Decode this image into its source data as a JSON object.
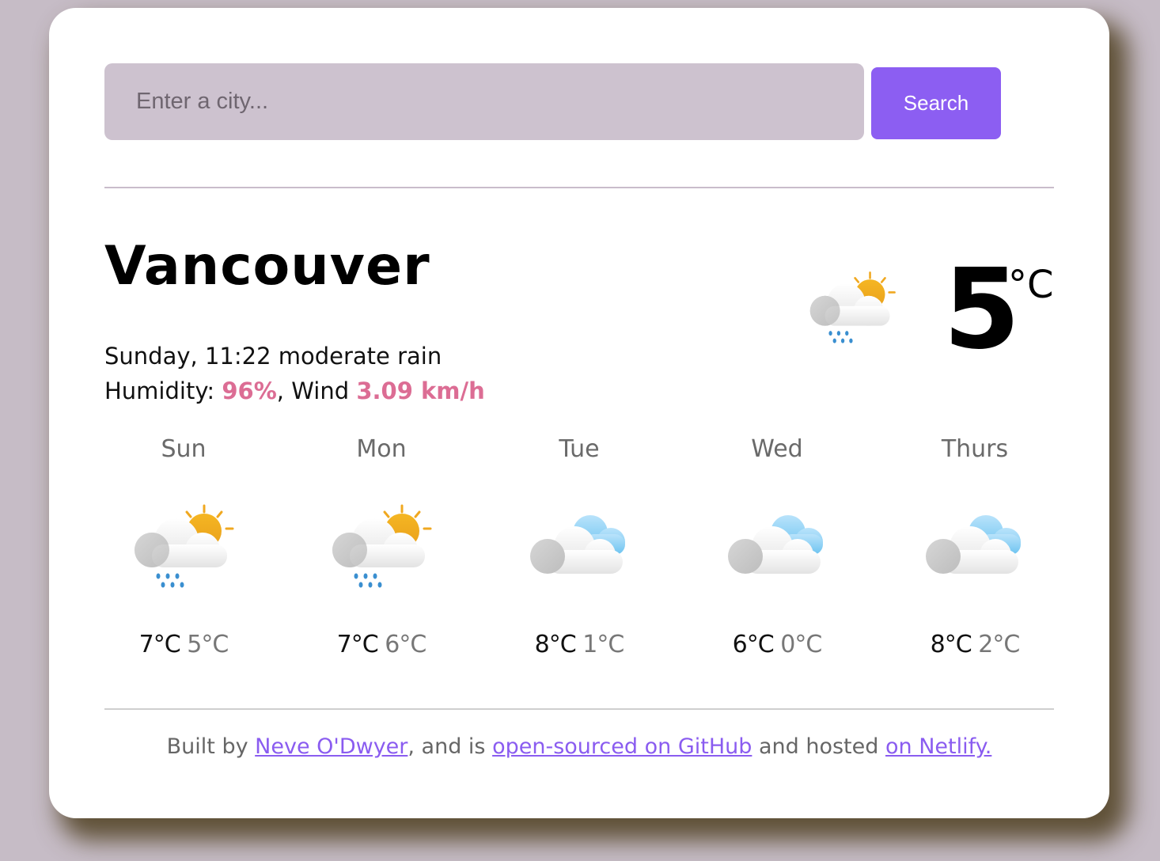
{
  "search": {
    "placeholder": "Enter a city...",
    "button_label": "Search"
  },
  "current": {
    "city": "Vancouver",
    "day_time": "Sunday, 11:22",
    "description": "moderate rain",
    "humidity_label": "Humidity:",
    "humidity_value": "96%",
    "wind_label": "Wind",
    "wind_value": "3.09 km/h",
    "temperature": "5",
    "unit": "°C",
    "icon": "partly-cloudy-rain-icon"
  },
  "forecast": [
    {
      "day": "Sun",
      "max": "7°C",
      "min": "5°C",
      "icon": "partly-cloudy-rain-icon"
    },
    {
      "day": "Mon",
      "max": "7°C",
      "min": "6°C",
      "icon": "partly-cloudy-rain-icon"
    },
    {
      "day": "Tue",
      "max": "8°C",
      "min": "1°C",
      "icon": "cloudy-icon"
    },
    {
      "day": "Wed",
      "max": "6°C",
      "min": "0°C",
      "icon": "cloudy-icon"
    },
    {
      "day": "Thurs",
      "max": "8°C",
      "min": "2°C",
      "icon": "cloudy-icon"
    }
  ],
  "footer": {
    "prefix": "Built by ",
    "author_link": "Neve O'Dwyer",
    "middle": ", and is ",
    "github_link": "open-sourced on GitHub",
    "hosted_text": " and hosted ",
    "netlify_link": "on Netlify."
  },
  "colors": {
    "accent": "#8c5ef2",
    "highlight": "#dc6d94",
    "input_bg": "#cdc2cf",
    "page_bg": "#c6bcc6"
  }
}
